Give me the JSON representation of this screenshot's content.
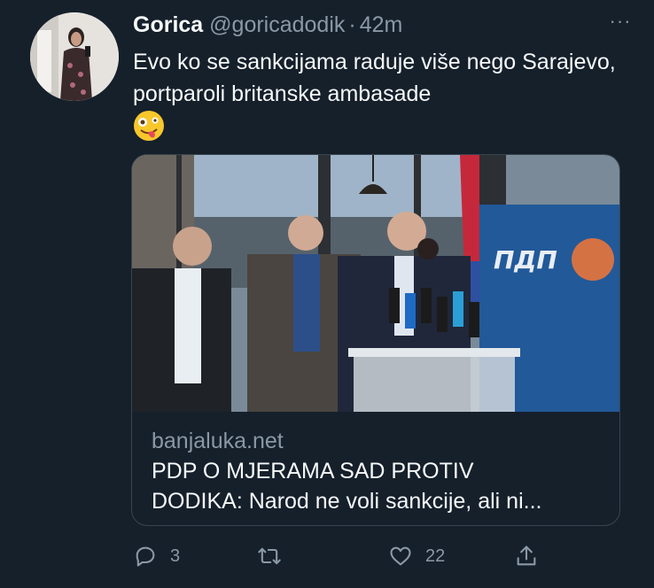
{
  "tweet": {
    "display_name": "Gorica",
    "handle": "@goricadodik",
    "separator": "·",
    "time": "42m",
    "more_label": "···",
    "text": "Evo ko se sankcijama raduje više nego Sarajevo, portparoli britanske ambasade",
    "emoji": "zany-face"
  },
  "card": {
    "domain": "banjaluka.net",
    "title": "PDP O MJERAMA SAD PROTIV\nDODIKA: Narod ne voli sankcije, ali ni..."
  },
  "actions": {
    "reply_count": "3",
    "retweet_count": "",
    "like_count": "22"
  },
  "icons": [
    "reply-icon",
    "retweet-icon",
    "like-icon",
    "share-icon",
    "more-icon"
  ],
  "colors": {
    "background": "#15202b",
    "text": "#f7f9f9",
    "secondary": "#8b98a5",
    "border": "#38444d"
  }
}
